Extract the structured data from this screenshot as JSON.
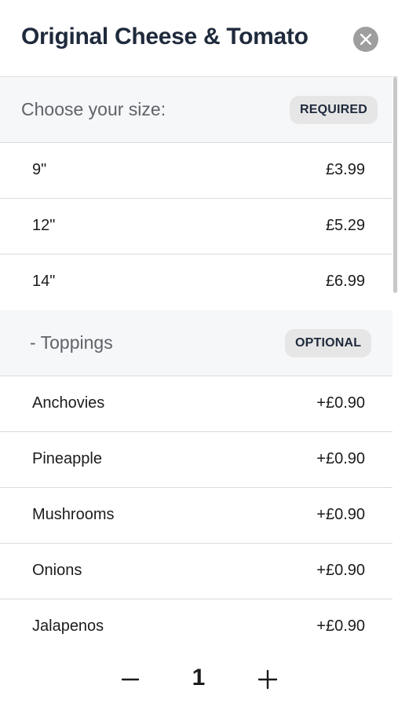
{
  "header": {
    "title": "Original Cheese & Tomato",
    "close_icon": "close-icon"
  },
  "size_section": {
    "label": "Choose your size:",
    "badge": "REQUIRED",
    "options": [
      {
        "label": "9\"",
        "price": "£3.99"
      },
      {
        "label": "12\"",
        "price": "£5.29"
      },
      {
        "label": "14\"",
        "price": "£6.99"
      }
    ]
  },
  "toppings_section": {
    "label": "- Toppings",
    "badge": "OPTIONAL",
    "options": [
      {
        "label": "Anchovies",
        "price": "+£0.90"
      },
      {
        "label": "Pineapple",
        "price": "+£0.90"
      },
      {
        "label": "Mushrooms",
        "price": "+£0.90"
      },
      {
        "label": "Onions",
        "price": "+£0.90"
      },
      {
        "label": "Jalapenos",
        "price": "+£0.90"
      }
    ]
  },
  "quantity": {
    "value": "1",
    "minus_icon": "minus-icon",
    "plus_icon": "plus-icon"
  }
}
